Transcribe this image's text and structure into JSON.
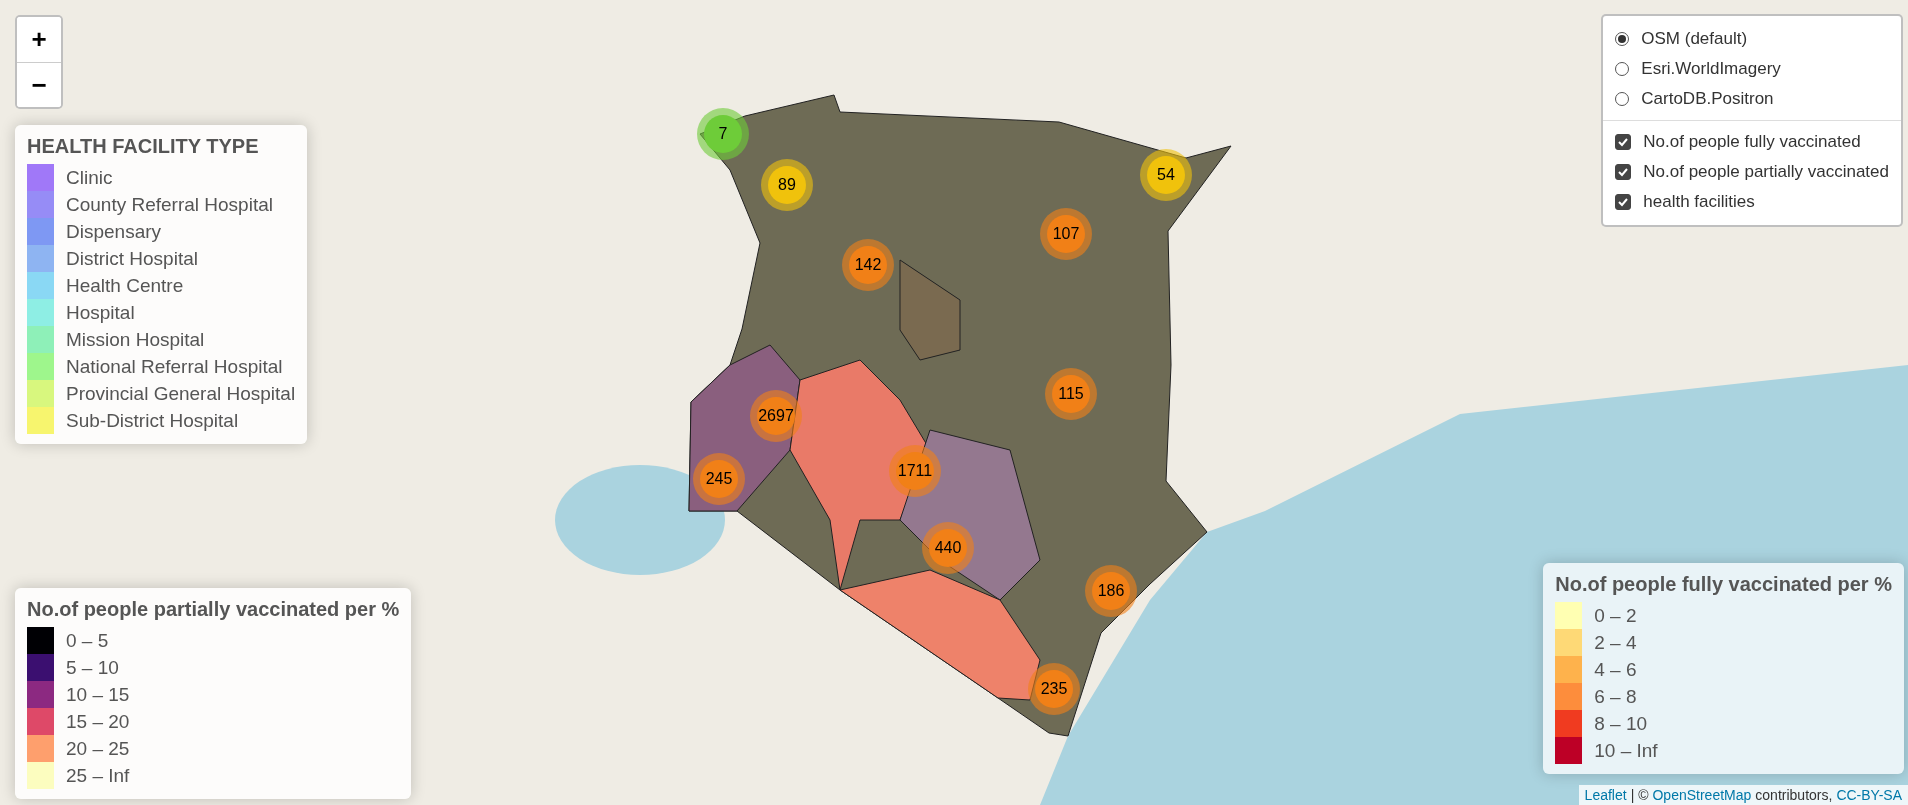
{
  "zoom_controls": [
    {
      "label": "+"
    },
    {
      "label": "−"
    }
  ],
  "facility_legend": {
    "title": "HEALTH FACILITY TYPE",
    "items": [
      {
        "label": "Clinic",
        "color": "#a078f8"
      },
      {
        "label": "County Referral Hospital",
        "color": "#968cf6"
      },
      {
        "label": "Dispensary",
        "color": "#7e98f3"
      },
      {
        "label": "District Hospital",
        "color": "#8eb4f2"
      },
      {
        "label": "Health Centre",
        "color": "#8ad8f4"
      },
      {
        "label": "Hospital",
        "color": "#8eeee4"
      },
      {
        "label": "Mission Hospital",
        "color": "#8ef0b8"
      },
      {
        "label": "National Referral Hospital",
        "color": "#9ef68c"
      },
      {
        "label": "Provincial General Hospital",
        "color": "#d8f77e"
      },
      {
        "label": "Sub-District Hospital",
        "color": "#f7f56e"
      }
    ]
  },
  "partial_legend": {
    "title": "No.of people partially vaccinated per %",
    "items": [
      {
        "label": "0 – 5",
        "color": "#000004"
      },
      {
        "label": "5 – 10",
        "color": "#3b0f70"
      },
      {
        "label": "10 – 15",
        "color": "#8c2981"
      },
      {
        "label": "15 – 20",
        "color": "#de4968"
      },
      {
        "label": "20 – 25",
        "color": "#fe9f6d"
      },
      {
        "label": "25 – Inf",
        "color": "#fcfdbf"
      }
    ]
  },
  "layers_control": {
    "base_layers": [
      {
        "label": "OSM (default)",
        "selected": true
      },
      {
        "label": "Esri.WorldImagery",
        "selected": false
      },
      {
        "label": "CartoDB.Positron",
        "selected": false
      }
    ],
    "overlays": [
      {
        "label": "No.of people fully vaccinated",
        "checked": true
      },
      {
        "label": "No.of people partially vaccinated",
        "checked": true
      },
      {
        "label": "health facilities",
        "checked": true
      }
    ]
  },
  "clusters": [
    {
      "count": "7",
      "color": "#6ecc39"
    },
    {
      "count": "89",
      "color": "#f0c20c"
    },
    {
      "count": "54",
      "color": "#f0c20c"
    },
    {
      "count": "107",
      "color": "#f18017"
    },
    {
      "count": "142",
      "color": "#f18017"
    },
    {
      "count": "115",
      "color": "#f18017"
    },
    {
      "count": "2697",
      "color": "#f18017"
    },
    {
      "count": "1711",
      "color": "#f18017"
    },
    {
      "count": "245",
      "color": "#f18017"
    },
    {
      "count": "440",
      "color": "#f18017"
    },
    {
      "count": "186",
      "color": "#f18017"
    },
    {
      "count": "235",
      "color": "#f18017"
    }
  ],
  "full_legend": {
    "title": "No.of people fully vaccinated per %",
    "items": [
      {
        "label": "0 – 2",
        "color": "#ffffb2"
      },
      {
        "label": "2 – 4",
        "color": "#fed976"
      },
      {
        "label": "4 – 6",
        "color": "#feb24c"
      },
      {
        "label": "6 – 8",
        "color": "#fd8d3c"
      },
      {
        "label": "8 – 10",
        "color": "#f03b20"
      },
      {
        "label": "10 – Inf",
        "color": "#bd0026"
      }
    ]
  },
  "attribution": [
    {
      "kind": "link",
      "text": "Leaflet"
    },
    {
      "kind": "text",
      "text": "| ©"
    },
    {
      "kind": "link",
      "text": "OpenStreetMap"
    },
    {
      "kind": "text",
      "text": "contributors,"
    },
    {
      "kind": "link",
      "text": "CC-BY-SA"
    }
  ]
}
